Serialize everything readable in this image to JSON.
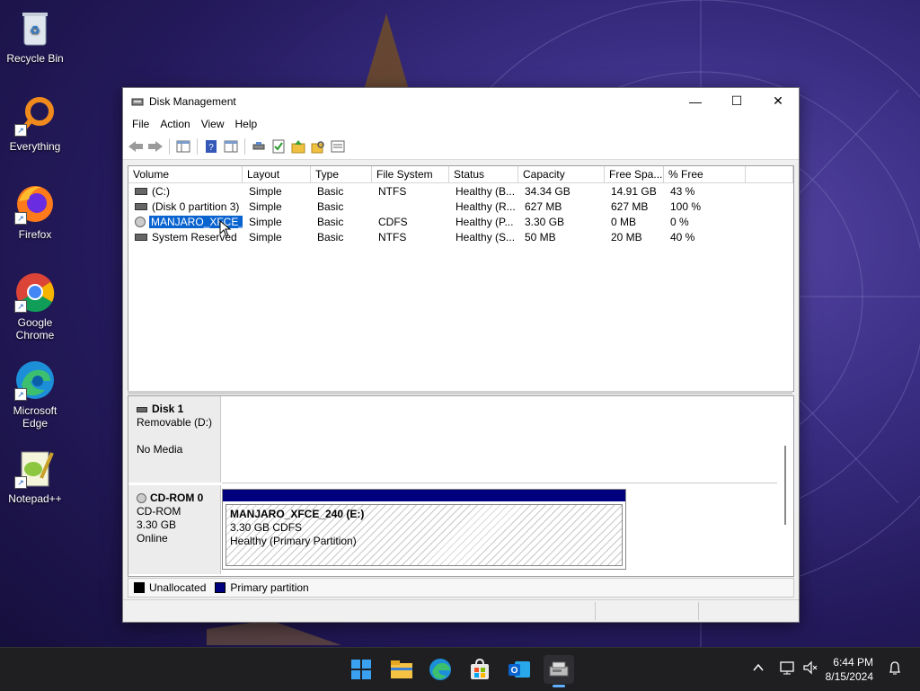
{
  "desktop": {
    "icons": [
      {
        "label": "Recycle Bin"
      },
      {
        "label": "Everything"
      },
      {
        "label": "Firefox"
      },
      {
        "label": "Google Chrome"
      },
      {
        "label": "Microsoft Edge"
      },
      {
        "label": "Notepad++"
      }
    ]
  },
  "window": {
    "title": "Disk Management",
    "controls": {
      "minimize": "—",
      "maximize": "☐",
      "close": "✕"
    },
    "menu": [
      "File",
      "Action",
      "View",
      "Help"
    ]
  },
  "volume_list": {
    "columns": [
      "Volume",
      "Layout",
      "Type",
      "File System",
      "Status",
      "Capacity",
      "Free Spa...",
      "% Free"
    ],
    "rows": [
      {
        "volume": "(C:)",
        "layout": "Simple",
        "type": "Basic",
        "fs": "NTFS",
        "status": "Healthy (B...",
        "capacity": "34.34 GB",
        "free": "14.91 GB",
        "pct": "43 %",
        "icon": "drive-icon"
      },
      {
        "volume": "(Disk 0 partition 3)",
        "layout": "Simple",
        "type": "Basic",
        "fs": "",
        "status": "Healthy (R...",
        "capacity": "627 MB",
        "free": "627 MB",
        "pct": "100 %",
        "icon": "drive-icon"
      },
      {
        "volume": "MANJARO_XFCE_...",
        "layout": "Simple",
        "type": "Basic",
        "fs": "CDFS",
        "status": "Healthy (P...",
        "capacity": "3.30 GB",
        "free": "0 MB",
        "pct": "0 %",
        "icon": "cd-icon",
        "selected": true
      },
      {
        "volume": "System Reserved",
        "layout": "Simple",
        "type": "Basic",
        "fs": "NTFS",
        "status": "Healthy (S...",
        "capacity": "50 MB",
        "free": "20 MB",
        "pct": "40 %",
        "icon": "drive-icon"
      }
    ]
  },
  "disks": {
    "disk1": {
      "name": "Disk 1",
      "kind": "Removable (D:)",
      "state": "No Media"
    },
    "cdrom0": {
      "name": "CD-ROM 0",
      "kind": "CD-ROM",
      "size": "3.30 GB",
      "state": "Online",
      "partition": {
        "name": "MANJARO_XFCE_240  (E:)",
        "size": "3.30 GB CDFS",
        "status": "Healthy (Primary Partition)"
      }
    }
  },
  "legend": {
    "unallocated": "Unallocated",
    "primary": "Primary partition",
    "colors": {
      "unallocated": "#000000",
      "primary": "#00007f"
    }
  },
  "taskbar": {
    "apps": [
      "start-icon",
      "file-explorer-icon",
      "edge-icon",
      "store-icon",
      "outlook-icon",
      "disk-management-icon"
    ],
    "time": "6:44 PM",
    "date": "8/15/2024"
  }
}
